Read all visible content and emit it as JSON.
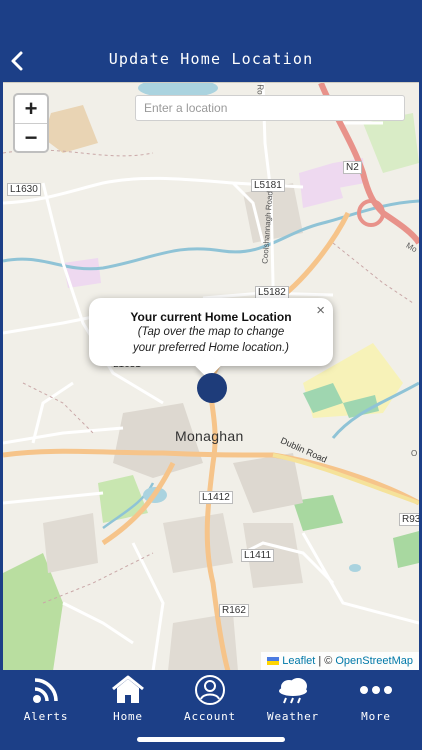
{
  "header": {
    "title": "Update Home Location",
    "back_icon": "chevron-left-icon"
  },
  "map": {
    "search": {
      "placeholder": "Enter a location",
      "value": ""
    },
    "zoom": {
      "in_label": "+",
      "out_label": "−"
    },
    "popup": {
      "title": "Your current Home Location",
      "subtitle_line1": "(Tap over the map to change",
      "subtitle_line2": "your preferred Home location.)",
      "close_label": "×"
    },
    "labels": {
      "town": "Monaghan",
      "dublin_road": "Dublin Road",
      "l1630": "L1630",
      "l5181": "L5181",
      "l5182": "L5182",
      "l1412": "L1412",
      "l1411": "L1411",
      "r162": "R162",
      "r93": "R93",
      "n2": "N2",
      "l1631": "L1631",
      "coolshannagh": "Coolshannagh Road",
      "ro": "Ro",
      "mo": "Mo",
      "o": "O"
    },
    "attribution": {
      "leaflet": "Leaflet",
      "separator": "| ©",
      "osm": "OpenStreetMap"
    }
  },
  "nav": {
    "items": [
      {
        "label": "Alerts",
        "icon": "rss-feed-icon"
      },
      {
        "label": "Home",
        "icon": "home-icon"
      },
      {
        "label": "Account",
        "icon": "account-icon"
      },
      {
        "label": "Weather",
        "icon": "weather-icon"
      },
      {
        "label": "More",
        "icon": "more-dots-icon"
      }
    ]
  },
  "colors": {
    "primary": "#1c3f87",
    "marker": "#1e3c7a",
    "map_bg": "#f1efe8",
    "road_major": "#f6c48a",
    "road_minor": "#ffffff",
    "water": "#8fc3d6",
    "park": "#b9dea0",
    "link": "#0078a8"
  }
}
